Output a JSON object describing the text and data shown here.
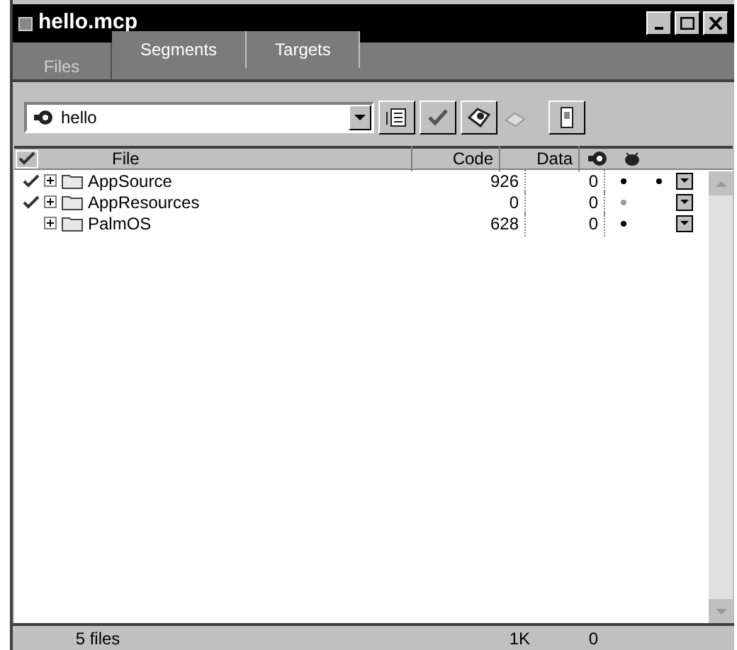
{
  "window": {
    "title": "hello.mcp"
  },
  "tabs": [
    {
      "label": "Files",
      "selected": true
    },
    {
      "label": "Segments",
      "selected": false
    },
    {
      "label": "Targets",
      "selected": false
    }
  ],
  "target_select": {
    "value": "hello"
  },
  "table": {
    "columns": [
      "File",
      "Code",
      "Data"
    ],
    "rows": [
      {
        "checked": true,
        "name": "AppSource",
        "code": "926",
        "data": "0",
        "color": "#000000",
        "debug": true
      },
      {
        "checked": true,
        "name": "AppResources",
        "code": "0",
        "data": "0",
        "color": "#999999",
        "debug": false
      },
      {
        "checked": false,
        "name": "PalmOS",
        "code": "628",
        "data": "0",
        "color": "#000000",
        "debug": false
      }
    ]
  },
  "status_bar": {
    "files": "5 files",
    "code": "1K",
    "data": "0"
  }
}
